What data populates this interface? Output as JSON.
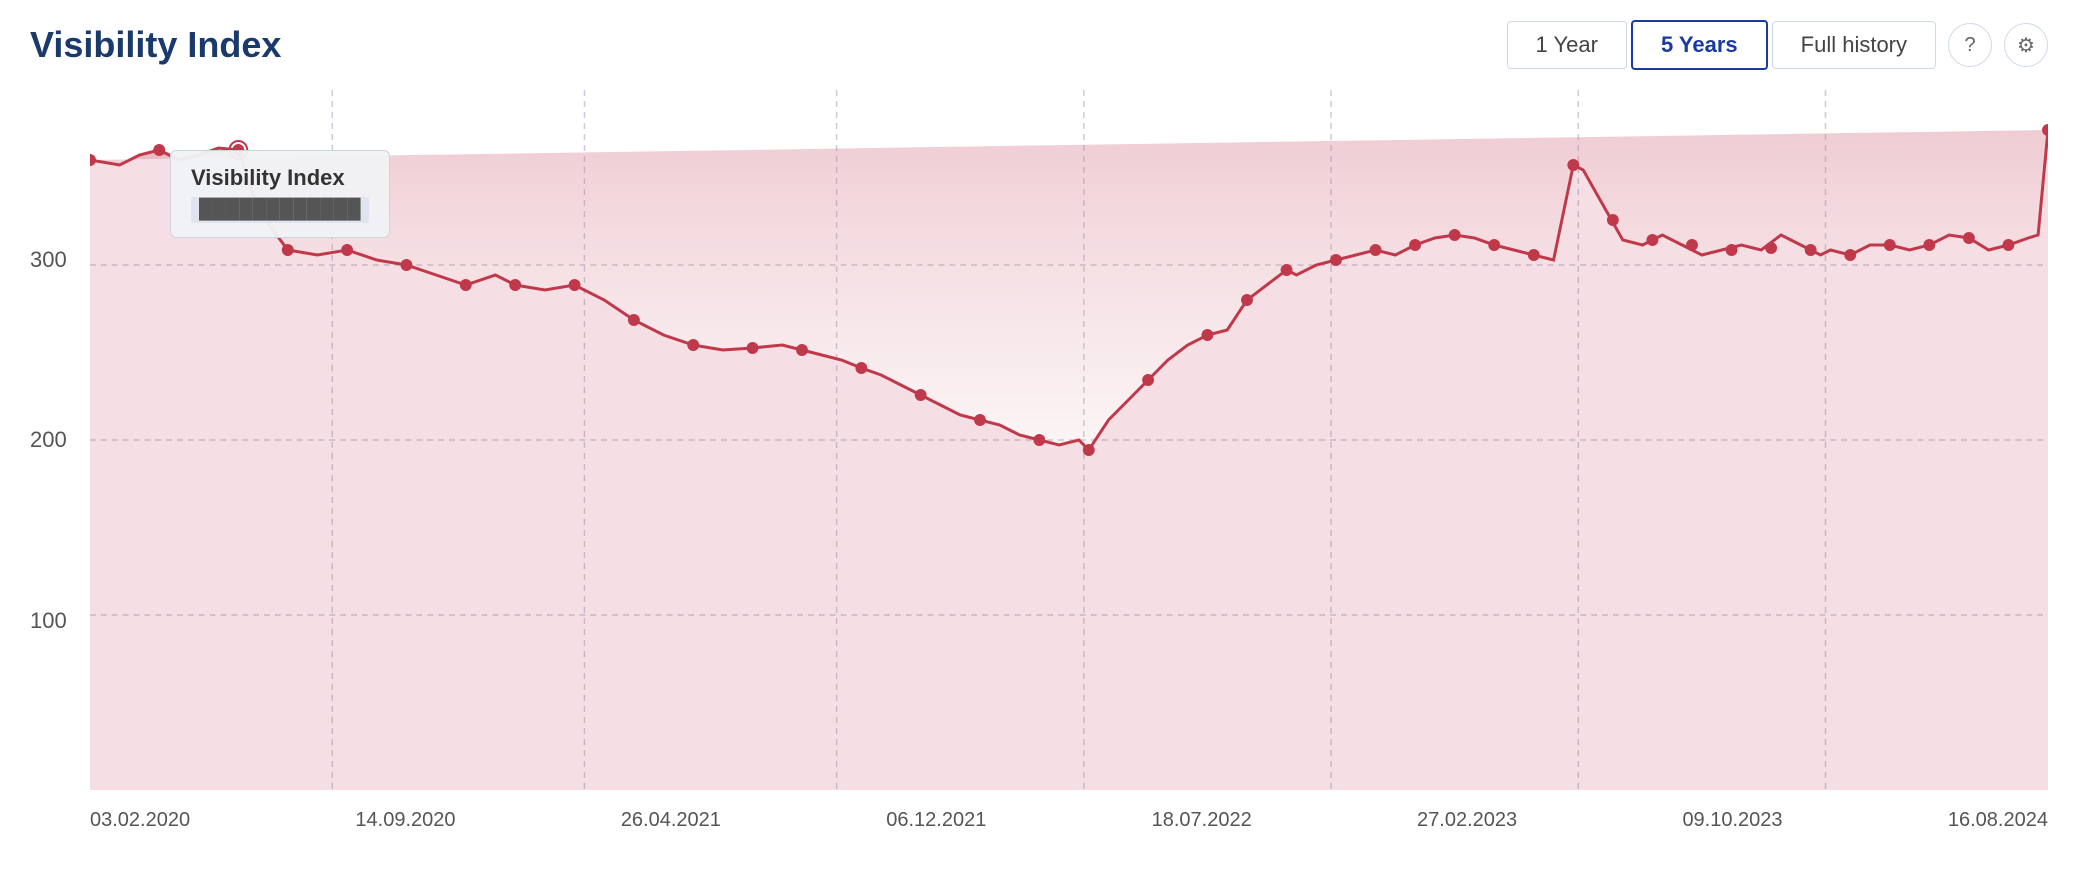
{
  "header": {
    "title": "Visibility Index"
  },
  "controls": {
    "buttons": [
      {
        "id": "1year",
        "label": "1 Year",
        "active": false
      },
      {
        "id": "5years",
        "label": "5 Years",
        "active": true
      },
      {
        "id": "fullhistory",
        "label": "Full history",
        "active": false
      }
    ]
  },
  "icons": {
    "help": "?",
    "settings": "⚙"
  },
  "tooltip": {
    "title": "Visibility Index",
    "value": "████████████"
  },
  "yAxis": {
    "labels": [
      "300",
      "200",
      "100"
    ]
  },
  "xAxis": {
    "labels": [
      "03.02.2020",
      "14.09.2020",
      "26.04.2021",
      "06.12.2021",
      "18.07.2022",
      "27.02.2023",
      "09.10.2023",
      "16.08.2024"
    ]
  },
  "chart": {
    "lineColor": "#c0394b",
    "fillColor": "rgba(220,120,140,0.25)",
    "gridColor": "#d8dce8"
  }
}
